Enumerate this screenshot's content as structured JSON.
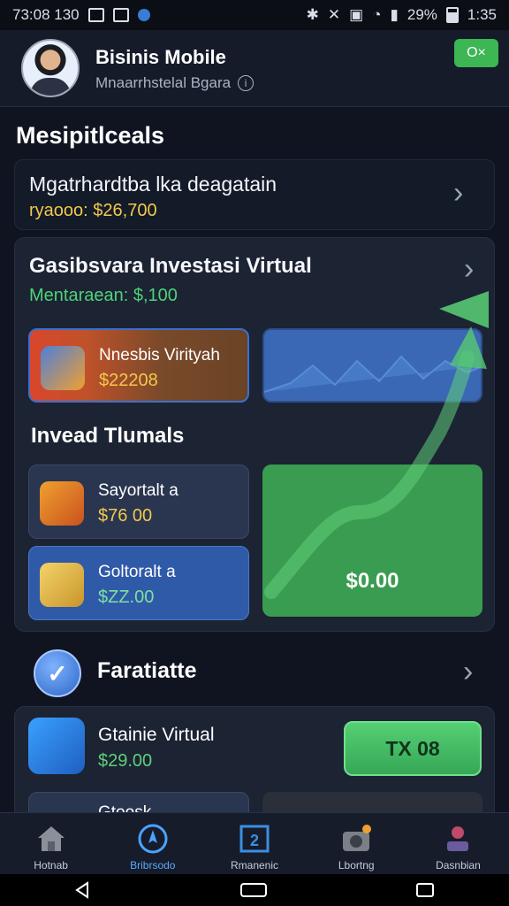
{
  "status_bar": {
    "time": "73:08 130",
    "battery": "29%",
    "clock_right": "1:35"
  },
  "header": {
    "title": "Bisinis Mobile",
    "subtitle": "Mnaarrhstelal Bgara",
    "ok_label": "O×"
  },
  "section_title": "Mesipitlceals",
  "summary_card": {
    "title": "Mgatrhardtba lka deagatain",
    "value": "ryaooo: $26,700"
  },
  "investment_panel": {
    "title": "Gasibsvara Investasi Virtual",
    "subtitle": "Mentaraean: $,100",
    "virtual_card": {
      "label": "Nnesbis Virityah",
      "value": "$22208"
    },
    "funds_title": "Invead Tlumals",
    "fund_items": [
      {
        "label": "Sayortalt a",
        "value": "$76 00"
      },
      {
        "label": "Goltoralt a",
        "value": "$ZZ.00"
      }
    ],
    "big_card_value": "$0.00"
  },
  "favorites": {
    "label": "Faratiatte"
  },
  "list": {
    "item_label": "Gtainie Virtual",
    "item_value": "$29.00",
    "action_label": "TX 08",
    "partial_item_label": "Gtoosk"
  },
  "bottom_nav": [
    {
      "label": "Hotnab",
      "icon": "home-icon"
    },
    {
      "label": "Bribrsodo",
      "icon": "compass-icon"
    },
    {
      "label": "Rmanenic",
      "icon": "calendar-icon"
    },
    {
      "label": "Lbortng",
      "icon": "camera-icon"
    },
    {
      "label": "Dasnbian",
      "icon": "profile-icon"
    }
  ],
  "colors": {
    "accent_green": "#3db654",
    "accent_blue": "#3a68b4",
    "value_yellow": "#f2c94c",
    "background": "#0f1420"
  }
}
